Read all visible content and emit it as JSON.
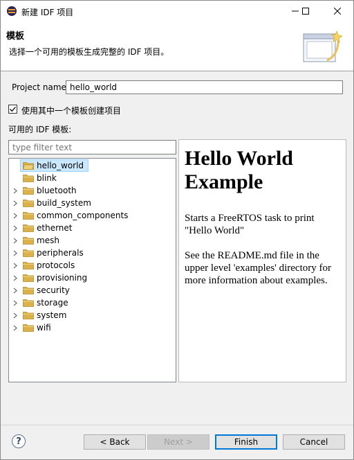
{
  "window": {
    "title": "新建 IDF 项目",
    "minimize_glyph": "—",
    "maximize_glyph": "☐",
    "close_glyph": "✕"
  },
  "banner": {
    "title": "模板",
    "description": "选择一个可用的模板生成完整的 IDF 项目。"
  },
  "form": {
    "project_name_label": "Project name:",
    "project_name_value": "hello_world",
    "use_template_label": "使用其中一个模板创建项目",
    "use_template_checked": true,
    "available_templates_label": "可用的 IDF 模板:",
    "filter_placeholder": "type filter text"
  },
  "tree": {
    "items": [
      {
        "label": "hello_world",
        "expandable": false,
        "selected": true
      },
      {
        "label": "blink",
        "expandable": false,
        "selected": false
      },
      {
        "label": "bluetooth",
        "expandable": true,
        "selected": false
      },
      {
        "label": "build_system",
        "expandable": true,
        "selected": false
      },
      {
        "label": "common_components",
        "expandable": true,
        "selected": false
      },
      {
        "label": "ethernet",
        "expandable": true,
        "selected": false
      },
      {
        "label": "mesh",
        "expandable": true,
        "selected": false
      },
      {
        "label": "peripherals",
        "expandable": true,
        "selected": false
      },
      {
        "label": "protocols",
        "expandable": true,
        "selected": false
      },
      {
        "label": "provisioning",
        "expandable": true,
        "selected": false
      },
      {
        "label": "security",
        "expandable": true,
        "selected": false
      },
      {
        "label": "storage",
        "expandable": true,
        "selected": false
      },
      {
        "label": "system",
        "expandable": true,
        "selected": false
      },
      {
        "label": "wifi",
        "expandable": true,
        "selected": false
      }
    ]
  },
  "preview": {
    "heading": "Hello World Example",
    "paragraph1": "Starts a FreeRTOS task to print \"Hello World\"",
    "paragraph2": "See the README.md file in the upper level 'examples' directory for more information about examples."
  },
  "footer": {
    "help_glyph": "?",
    "back_label": "< Back",
    "next_label": "Next >",
    "finish_label": "Finish",
    "cancel_label": "Cancel"
  },
  "colors": {
    "selection_fill": "#cce8ff",
    "selection_border": "#99d1ff",
    "default_button_border": "#0078d7",
    "folder": "#dcb04a"
  }
}
